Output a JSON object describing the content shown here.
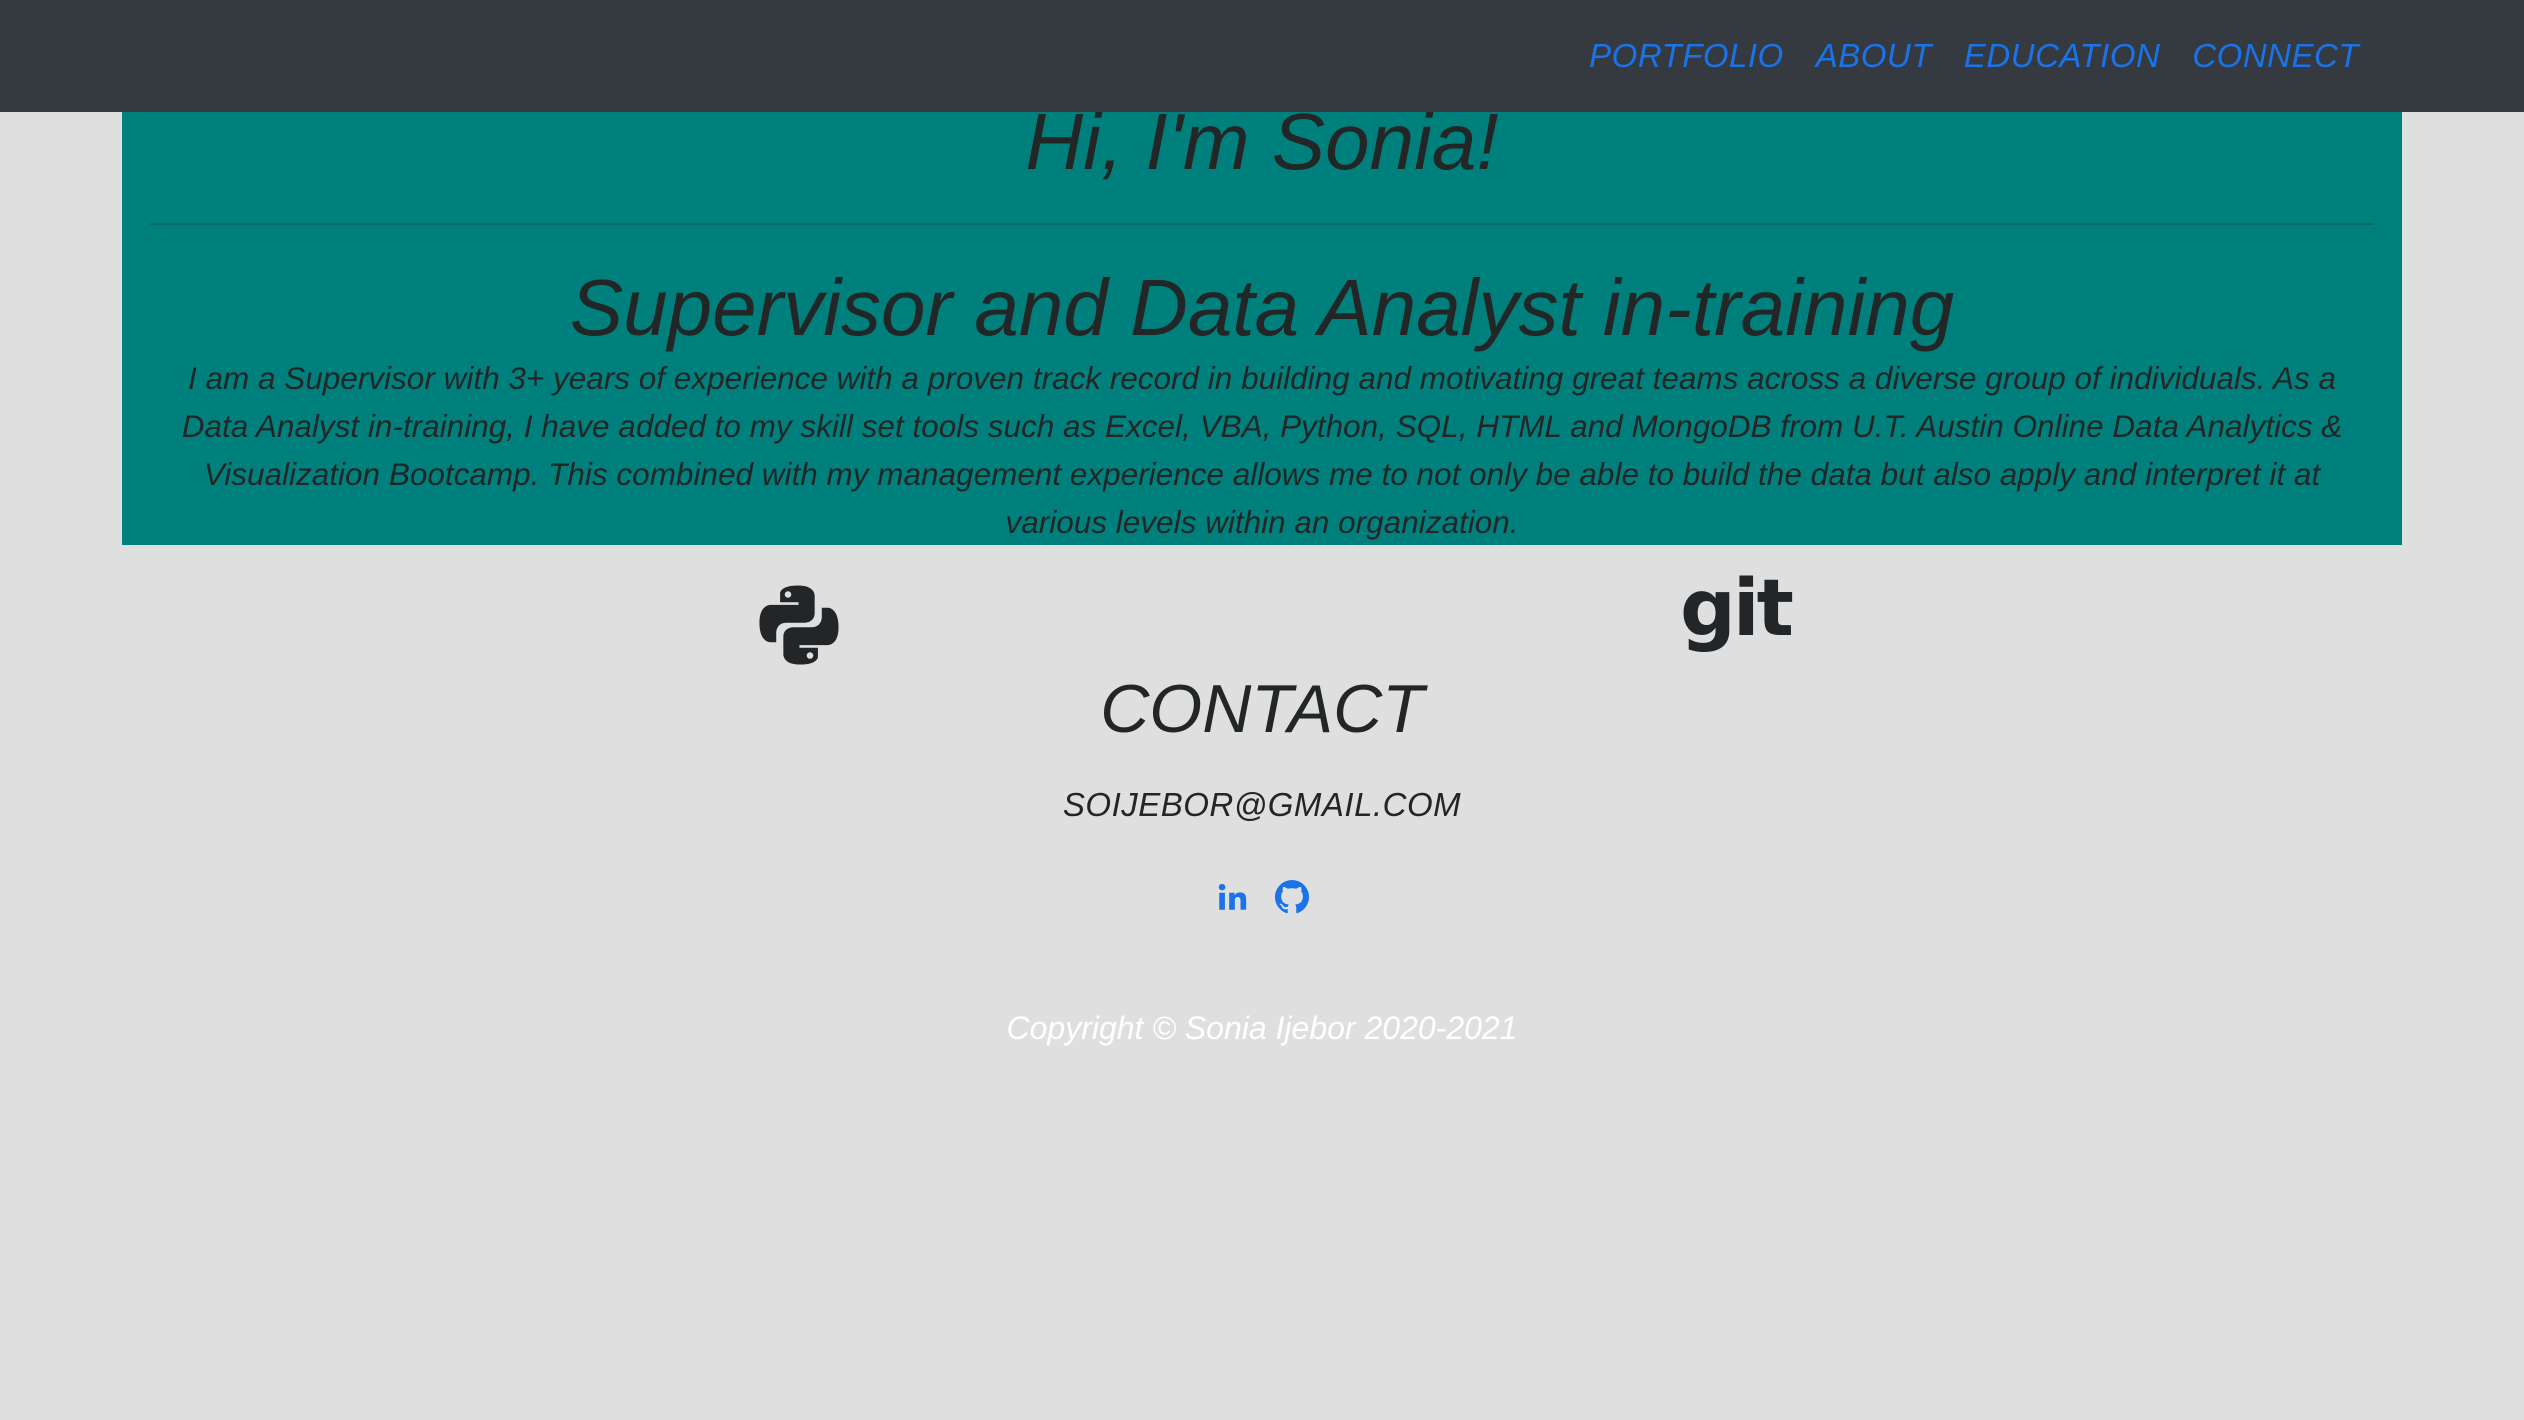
{
  "nav": {
    "items": [
      {
        "label": "PORTFOLIO"
      },
      {
        "label": "ABOUT"
      },
      {
        "label": "EDUCATION"
      },
      {
        "label": "CONNECT"
      }
    ]
  },
  "hero": {
    "title": "Hi, I'm Sonia!",
    "subtitle": "Supervisor and Data Analyst in-training",
    "description": "I am a Supervisor with 3+ years of experience with a proven track record in building and motivating great teams across a diverse group of individuals. As a Data Analyst in-training, I have added to my skill set tools such as Excel, VBA, Python, SQL, HTML and MongoDB from U.T. Austin Online Data Analytics & Visualization Bootcamp. This combined with my management experience allows me to not only be able to build the data but also apply and interpret it at various levels within an organization."
  },
  "skills": {
    "icons": [
      "python-icon",
      "git-icon"
    ],
    "git_text": "git"
  },
  "contact": {
    "title": "CONTACT",
    "email": "SOIJEBOR@GMAIL.COM",
    "social_icons": [
      "linkedin-icon",
      "github-icon"
    ]
  },
  "footer": {
    "copyright": "Copyright © Sonia Ijebor 2020-2021"
  },
  "colors": {
    "navbar_bg": "#343a3f",
    "link": "#1a73e8",
    "hero_bg": "#00807d",
    "page_bg": "#e0dfdf",
    "text": "#222626"
  }
}
